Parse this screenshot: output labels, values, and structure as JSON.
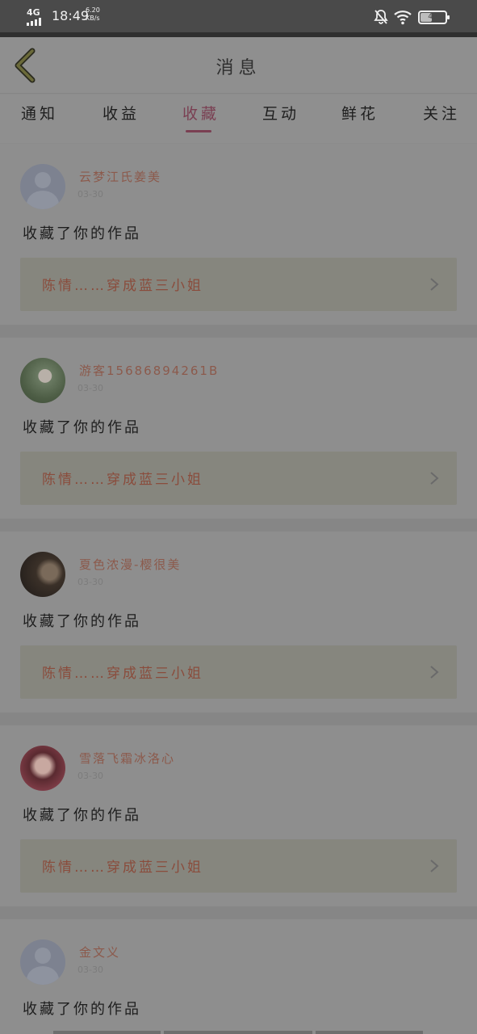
{
  "status_bar": {
    "network": "4G",
    "time": "18:49",
    "speed_top": "6.20",
    "speed_bottom": "KB/s",
    "battery": "48",
    "battery_level": 0.48
  },
  "header": {
    "title": "消息"
  },
  "tabs": [
    {
      "label": "通知",
      "active": false
    },
    {
      "label": "收益",
      "active": false
    },
    {
      "label": "收藏",
      "active": true
    },
    {
      "label": "互动",
      "active": false
    },
    {
      "label": "鲜花",
      "active": false
    },
    {
      "label": "关注",
      "active": false
    }
  ],
  "messages": [
    {
      "user": "云梦江氏姜美",
      "date": "03-30",
      "action": "收藏了你的作品",
      "work": "陈情……穿成蓝三小姐"
    },
    {
      "user": "游客15686894261B",
      "date": "03-30",
      "action": "收藏了你的作品",
      "work": "陈情……穿成蓝三小姐"
    },
    {
      "user": "夏色浓漫-樱很美",
      "date": "03-30",
      "action": "收藏了你的作品",
      "work": "陈情……穿成蓝三小姐"
    },
    {
      "user": "雪落飞霜冰洛心",
      "date": "03-30",
      "action": "收藏了你的作品",
      "work": "陈情……穿成蓝三小姐"
    },
    {
      "user": "金文义",
      "date": "03-30",
      "action": "收藏了你的作品"
    }
  ],
  "colors": {
    "accent": "#7a3f52",
    "username": "#8c5a4c",
    "work_title": "#8a4c3c"
  }
}
